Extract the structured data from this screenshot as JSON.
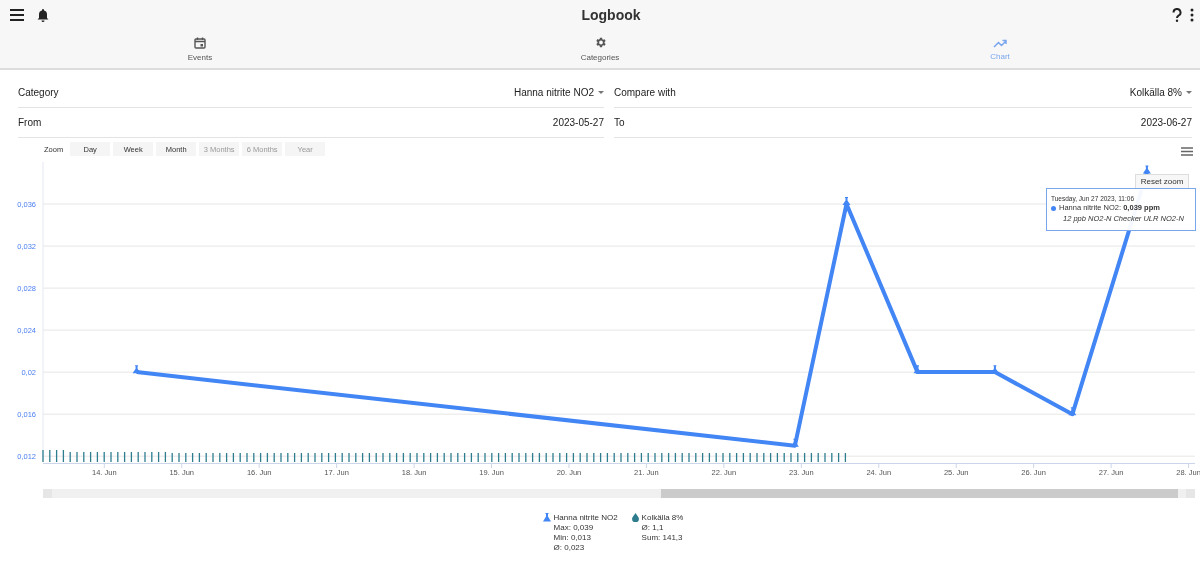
{
  "app_bar": {
    "title": "Logbook"
  },
  "tabs": [
    {
      "label": "Events",
      "selected": false
    },
    {
      "label": "Categories",
      "selected": false
    },
    {
      "label": "Chart",
      "selected": true
    }
  ],
  "filters": [
    {
      "label": "Category",
      "value": "Hanna nitrite NO2",
      "kind": "dropdown"
    },
    {
      "label": "Compare with",
      "value": "Kolkälla 8%",
      "kind": "dropdown"
    },
    {
      "label": "From",
      "value": "2023-05-27",
      "kind": "date"
    },
    {
      "label": "To",
      "value": "2023-06-27",
      "kind": "date"
    }
  ],
  "zoom": {
    "label": "Zoom",
    "buttons": [
      {
        "label": "Day",
        "disabled": false
      },
      {
        "label": "Week",
        "disabled": false
      },
      {
        "label": "Month",
        "disabled": false
      },
      {
        "label": "3 Months",
        "disabled": true
      },
      {
        "label": "6 Months",
        "disabled": true
      },
      {
        "label": "Year",
        "disabled": true
      }
    ]
  },
  "chart": {
    "reset_button": "Reset zoom",
    "tooltip": {
      "date": "Tuesday, Jun 27 2023, 11:06",
      "value": ": **0,039 ppm**",
      "note": "12 ppb NO2-N Checker ULR NO2-N"
    },
    "chart_data": {
      "type": "line",
      "x": [
        "2023-06-14T10:00",
        "2023-06-22T22:00",
        "2023-06-23T14:00",
        "2023-06-24T12:00",
        "2023-06-25T12:00",
        "2023-06-26T12:00",
        "2023-06-27T11:06"
      ],
      "series": [
        {
          "name": "Hanna nitrite NO2",
          "color": "#4285f4",
          "values": [
            0.02,
            0.013,
            0.036,
            0.02,
            0.02,
            0.016,
            0.039
          ]
        }
      ],
      "xlim": [
        "2023-06-13T05:00",
        "2023-06-28T02:00"
      ],
      "ylim": [
        0.0116,
        0.04
      ],
      "grid": true,
      "xticks": [
        {
          "value": "2023-06-14",
          "label": "14. Jun"
        },
        {
          "value": "2023-06-15",
          "label": "15. Jun"
        },
        {
          "value": "2023-06-16",
          "label": "16. Jun"
        },
        {
          "value": "2023-06-17",
          "label": "17. Jun"
        },
        {
          "value": "2023-06-18",
          "label": "18. Jun"
        },
        {
          "value": "2023-06-19",
          "label": "19. Jun"
        },
        {
          "value": "2023-06-20",
          "label": "20. Jun"
        },
        {
          "value": "2023-06-21",
          "label": "21. Jun"
        },
        {
          "value": "2023-06-22",
          "label": "22. Jun"
        },
        {
          "value": "2023-06-23",
          "label": "23. Jun"
        },
        {
          "value": "2023-06-24",
          "label": "24. Jun"
        },
        {
          "value": "2023-06-25",
          "label": "25. Jun"
        },
        {
          "value": "2023-06-26",
          "label": "26. Jun"
        },
        {
          "value": "2023-06-27",
          "label": "27. Jun"
        },
        {
          "value": "2023-06-28",
          "label": "28. Jun"
        }
      ],
      "yticks": [
        {
          "value": 0.012,
          "label": "0,012"
        },
        {
          "value": 0.016,
          "label": "0,016"
        },
        {
          "value": 0.02,
          "label": "0,02"
        },
        {
          "value": 0.024,
          "label": "0,024"
        },
        {
          "value": 0.028,
          "label": "0,028"
        },
        {
          "value": 0.032,
          "label": "0,032"
        },
        {
          "value": 0.036,
          "label": "0,036"
        }
      ]
    }
  },
  "legend": [
    {
      "name": "Hanna nitrite NO2",
      "kind": "flask",
      "color": "#4285f4",
      "stats": [
        "Max: 0,039",
        "Min: 0,013",
        "Ø: 0,023"
      ]
    },
    {
      "name": "Kolkälla 8%",
      "kind": "drop",
      "color": "#2e7d8f",
      "stats": [
        "Ø: 1,1",
        "Sum: 141,3"
      ]
    }
  ]
}
